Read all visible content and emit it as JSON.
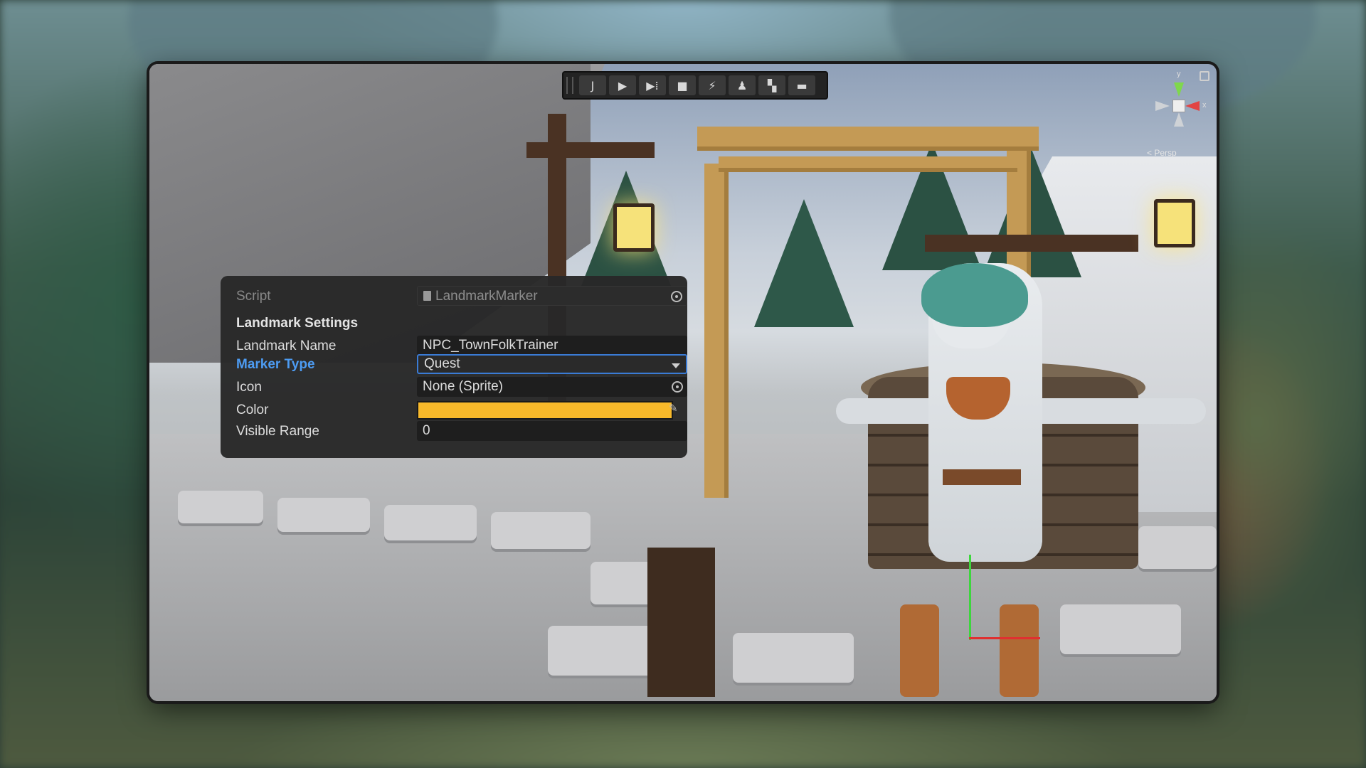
{
  "toolbar": {
    "buttons": [
      {
        "name": "view-tool",
        "icon": "J"
      },
      {
        "name": "play",
        "icon": "▶"
      },
      {
        "name": "step",
        "icon": "▶⁞"
      },
      {
        "name": "stop",
        "icon": "■"
      },
      {
        "name": "lightning",
        "icon": "⚡"
      },
      {
        "name": "character",
        "icon": "♟"
      },
      {
        "name": "layout",
        "icon": "▚"
      },
      {
        "name": "toolbox",
        "icon": "▬"
      }
    ]
  },
  "gizmo": {
    "y_label": "y",
    "x_label": "x",
    "projection_label": "< Persp"
  },
  "inspector": {
    "script_label": "Script",
    "script_value": "LandmarkMarker",
    "section_header": "Landmark Settings",
    "landmark_name_label": "Landmark Name",
    "landmark_name_value": "NPC_TownFolkTrainer",
    "marker_type_label": "Marker Type",
    "marker_type_value": "Quest",
    "icon_label": "Icon",
    "icon_value": "None (Sprite)",
    "color_label": "Color",
    "color_value": "#f8b92a",
    "visible_range_label": "Visible Range",
    "visible_range_value": "0"
  },
  "colors": {
    "accent": "#4d9cf3",
    "swatch": "#f8b92a"
  }
}
